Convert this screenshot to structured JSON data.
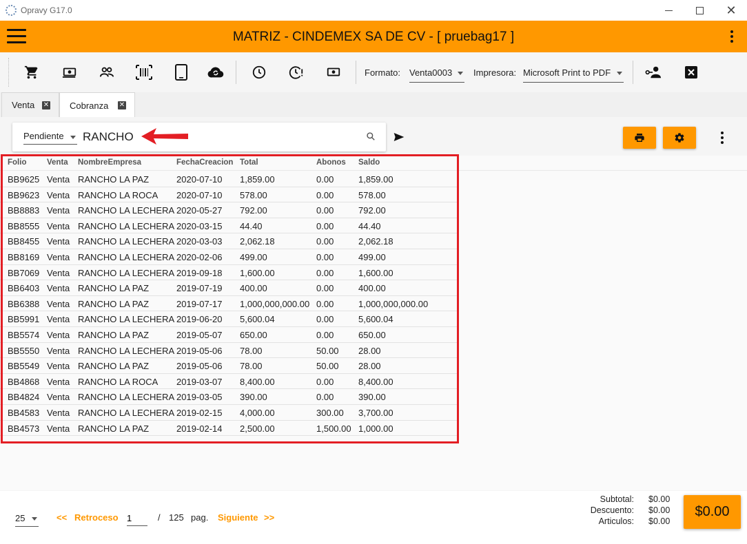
{
  "window": {
    "title": "Opravy G17.0"
  },
  "header": {
    "title": "MATRIZ - CINDEMEX SA DE CV - [ pruebag17 ]"
  },
  "toolbar": {
    "formato_label": "Formato:",
    "formato_value": "Venta0003",
    "impresora_label": "Impresora:",
    "impresora_value": "Microsoft Print to PDF"
  },
  "tabs": [
    {
      "label": "Venta"
    },
    {
      "label": "Cobranza"
    }
  ],
  "search": {
    "status": "Pendiente",
    "query": "RANCHO"
  },
  "table": {
    "headers": [
      "Folio",
      "Venta",
      "NombreEmpresa",
      "FechaCreacion",
      "Total",
      "Abonos",
      "Saldo"
    ],
    "rows": [
      [
        "BB9625",
        "Venta",
        "RANCHO LA PAZ",
        "2020-07-10",
        "1,859.00",
        "0.00",
        "1,859.00"
      ],
      [
        "BB9623",
        "Venta",
        "RANCHO LA ROCA",
        "2020-07-10",
        "578.00",
        "0.00",
        "578.00"
      ],
      [
        "BB8883",
        "Venta",
        "RANCHO LA LECHERA",
        "2020-05-27",
        "792.00",
        "0.00",
        "792.00"
      ],
      [
        "BB8555",
        "Venta",
        "RANCHO LA LECHERA",
        "2020-03-15",
        "44.40",
        "0.00",
        "44.40"
      ],
      [
        "BB8455",
        "Venta",
        "RANCHO LA LECHERA",
        "2020-03-03",
        "2,062.18",
        "0.00",
        "2,062.18"
      ],
      [
        "BB8169",
        "Venta",
        "RANCHO LA LECHERA",
        "2020-02-06",
        "499.00",
        "0.00",
        "499.00"
      ],
      [
        "BB7069",
        "Venta",
        "RANCHO LA LECHERA",
        "2019-09-18",
        "1,600.00",
        "0.00",
        "1,600.00"
      ],
      [
        "BB6403",
        "Venta",
        "RANCHO LA PAZ",
        "2019-07-19",
        "400.00",
        "0.00",
        "400.00"
      ],
      [
        "BB6388",
        "Venta",
        "RANCHO LA PAZ",
        "2019-07-17",
        "1,000,000,000.00",
        "0.00",
        "1,000,000,000.00"
      ],
      [
        "BB5991",
        "Venta",
        "RANCHO LA LECHERA",
        "2019-06-20",
        "5,600.04",
        "0.00",
        "5,600.04"
      ],
      [
        "BB5574",
        "Venta",
        "RANCHO LA PAZ",
        "2019-05-07",
        "650.00",
        "0.00",
        "650.00"
      ],
      [
        "BB5550",
        "Venta",
        "RANCHO LA LECHERA",
        "2019-05-06",
        "78.00",
        "50.00",
        "28.00"
      ],
      [
        "BB5549",
        "Venta",
        "RANCHO LA PAZ",
        "2019-05-06",
        "78.00",
        "50.00",
        "28.00"
      ],
      [
        "BB4868",
        "Venta",
        "RANCHO LA ROCA",
        "2019-03-07",
        "8,400.00",
        "0.00",
        "8,400.00"
      ],
      [
        "BB4824",
        "Venta",
        "RANCHO LA LECHERA",
        "2019-03-05",
        "390.00",
        "0.00",
        "390.00"
      ],
      [
        "BB4583",
        "Venta",
        "RANCHO LA LECHERA",
        "2019-02-15",
        "4,000.00",
        "300.00",
        "3,700.00"
      ],
      [
        "BB4573",
        "Venta",
        "RANCHO LA PAZ",
        "2019-02-14",
        "2,500.00",
        "1,500.00",
        "1,000.00"
      ]
    ]
  },
  "pagination": {
    "page_size": "25",
    "prev_arrows": "<<",
    "prev_label": "Retroceso",
    "current_page": "1",
    "separator": "/",
    "total_pages": "125",
    "pag_label": "pag.",
    "next_label": "Siguiente",
    "next_arrows": ">>"
  },
  "totals": {
    "subtotal_label": "Subtotal:",
    "subtotal": "$0.00",
    "descuento_label": "Descuento:",
    "descuento": "$0.00",
    "articulos_label": "Articulos:",
    "articulos": "$0.00",
    "grand_total": "$0.00"
  },
  "colors": {
    "accent": "#ff9800",
    "annotation": "#e31e24"
  },
  "icons": [
    "menu-icon",
    "cart-icon",
    "money-icon",
    "users-icon",
    "barcode-icon",
    "tablet-icon",
    "cloud-sync-icon",
    "clock-icon",
    "clock-alert-icon",
    "cash-icon",
    "user-key-icon",
    "close-box-icon",
    "search-icon",
    "send-icon",
    "print-icon",
    "gear-icon",
    "kebab-icon"
  ]
}
